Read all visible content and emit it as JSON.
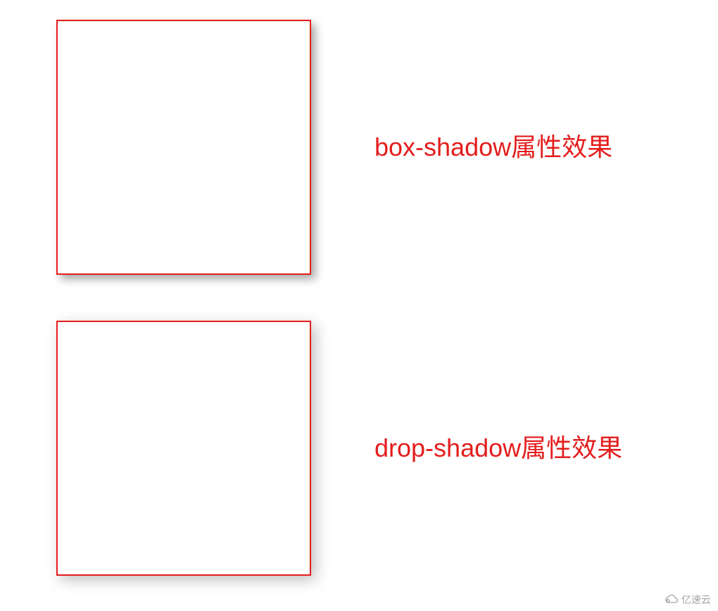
{
  "demo1": {
    "label": "box-shadow属性效果"
  },
  "demo2": {
    "label": "drop-shadow属性效果"
  },
  "watermark": {
    "text": "亿速云"
  }
}
